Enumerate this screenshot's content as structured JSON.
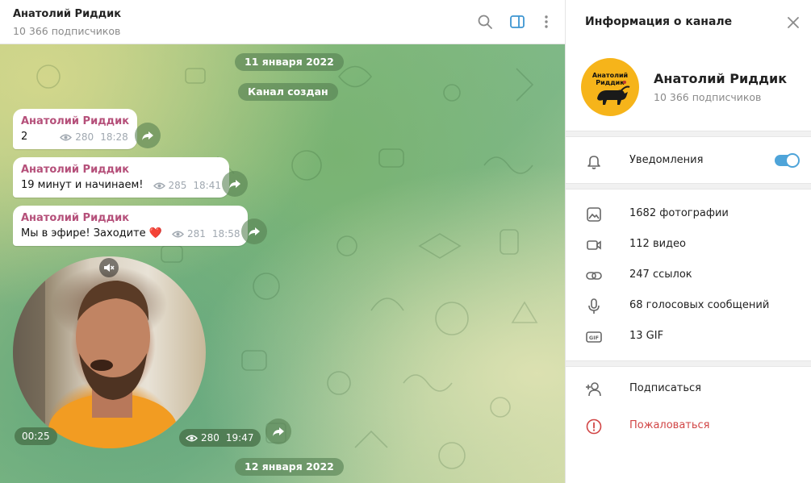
{
  "header": {
    "title": "Анатолий Риддик",
    "subtitle": "10 366 подписчиков"
  },
  "messages": {
    "date1": "11 января 2022",
    "service": "Канал создан",
    "date2": "12 января 2022",
    "items": [
      {
        "author": "Анатолий Риддик",
        "text": "2",
        "views": "280",
        "time": "18:28"
      },
      {
        "author": "Анатолий Риддик",
        "text": "19 минут и начинаем!",
        "views": "285",
        "time": "18:41"
      },
      {
        "author": "Анатолий Риддик",
        "text": "Мы в эфире! Заходите ❤️",
        "views": "281",
        "time": "18:58"
      }
    ],
    "video": {
      "duration": "00:25",
      "views": "280",
      "time": "19:47"
    }
  },
  "panel": {
    "title": "Информация о канале",
    "name": "Анатолий Риддик",
    "subscribers": "10 366 подписчиков",
    "avatar_text_top": "Анатолий",
    "avatar_text_bottom": "Риддик",
    "notifications": "Уведомления",
    "notifications_on": true,
    "media": [
      {
        "icon": "photo-icon",
        "label": "1682 фотографии"
      },
      {
        "icon": "video-icon",
        "label": "112 видео"
      },
      {
        "icon": "link-icon",
        "label": "247 ссылок"
      },
      {
        "icon": "microphone-icon",
        "label": "68 голосовых сообщений"
      },
      {
        "icon": "gif-icon",
        "label": "13 GIF"
      }
    ],
    "subscribe": "Подписаться",
    "report": "Пожаловаться"
  },
  "colors": {
    "accent": "#4ea4d9",
    "author": "#b5507a",
    "report": "#d14545"
  }
}
